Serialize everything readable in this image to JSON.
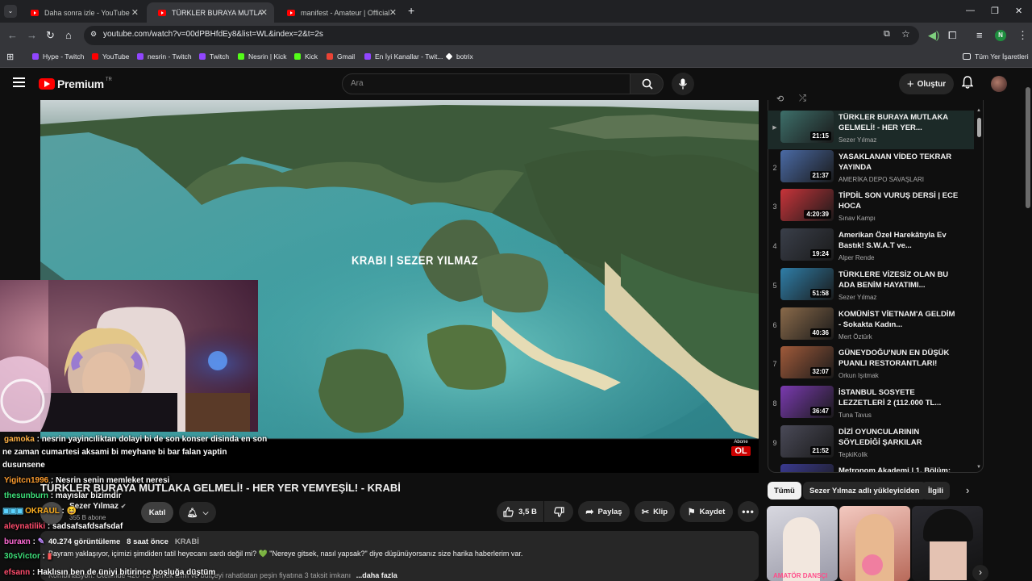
{
  "browser": {
    "tabs": [
      {
        "title": "Daha sonra izle - YouTube"
      },
      {
        "title": "TÜRKLER BURAYA MUTLAKA G"
      },
      {
        "title": "manifest - Amateur | Official M"
      }
    ],
    "url": "youtube.com/watch?v=00dPBHfdEy8&list=WL&index=2&t=2s",
    "profile_initial": "N",
    "bookmarks": [
      {
        "label": "Hype - Twitch",
        "color": "#9146ff"
      },
      {
        "label": "YouTube",
        "color": "#ff0000"
      },
      {
        "label": "nesrin - Twitch",
        "color": "#9146ff"
      },
      {
        "label": "Twitch",
        "color": "#9146ff"
      },
      {
        "label": "Nesrin | Kick",
        "color": "#53fc18"
      },
      {
        "label": "Kick",
        "color": "#53fc18"
      },
      {
        "label": "Gmail",
        "color": "#ea4335"
      },
      {
        "label": "En İyi Kanallar - Twit...",
        "color": "#9146ff"
      },
      {
        "label": "botrix",
        "color": "#ffffff"
      }
    ],
    "all_bookmarks": "Tüm Yer İşaretleri"
  },
  "youtube": {
    "logo_text": "Premium",
    "country": "TR",
    "search_placeholder": "Ara",
    "create_label": "Oluştur"
  },
  "video": {
    "overlay_text": "KRABI | SEZER YILMAZ",
    "subscribe_badge_line1": "Abone",
    "subscribe_badge_line2": "OL",
    "title": "TÜRKLER BURAYA MUTLAKA GELMELİ! - HER YER YEMYEŞİL! - KRABİ",
    "channel": "Sezer Yılmaz",
    "subscribers": "355 B abone",
    "join_label": "Katıl",
    "likes": "3,5 B",
    "share_label": "Paylaş",
    "clip_label": "Klip",
    "save_label": "Kaydet",
    "views": "40.274 görüntüleme",
    "age": "8 saat önce",
    "tag": "KRABİ",
    "desc_line1": "Bayram yaklaşıyor, içimizi şimdiden tatil heyecanı sardı değil mi? 💚 \"Nereye gitsek, nasıl yapsak?\" diye düşünüyorsanız size harika haberlerim var.",
    "desc_line2": "Kombinasyon: Otelimde 420 TL yemek alım ve bütçeyi rahatlatan peşin fiyatına 3 taksit imkanı",
    "more_label": "...daha fazla"
  },
  "chat": [
    {
      "user": "gamoka",
      "color": "#ffb347",
      "text": "nesrin yayincıliktan dolayi bi de son konser disinda en son"
    },
    {
      "user": "",
      "color": "#ffffff",
      "text": "ne zaman cumartesi aksami bi meyhane bi bar falan yaptin"
    },
    {
      "user": "",
      "color": "#ffffff",
      "text": "dusunsene"
    },
    {
      "user": "Yigitcn1996",
      "color": "#ff9d2e",
      "text": "Nesrin senin memleket neresi"
    },
    {
      "user": "thesunburn",
      "color": "#3ee07a",
      "text": "mayıslar bizimdir"
    },
    {
      "user": "OKRAUL",
      "color": "#ffb020",
      "text": "😆"
    },
    {
      "user": "aleynatiliki",
      "color": "#ff4d6d",
      "text": "sadsafsafdsafsdaf"
    },
    {
      "user": "buraкn",
      "color": "#ff6ad5",
      "text": ""
    },
    {
      "user": "30sVictor",
      "color": "#3ee07a",
      "text": ""
    },
    {
      "user": "efsann",
      "color": "#ff4d6d",
      "text": "Haklısın ben de üniyi bitirince boşluğa düştüm"
    }
  ],
  "playlist": [
    {
      "num": "▶",
      "title": "TÜRKLER BURAYA MUTLAKA GELMELİ! - HER YER...",
      "channel": "Sezer Yılmaz",
      "duration": "21:15",
      "thumb": "#3d6f6a",
      "active": true
    },
    {
      "num": "2",
      "title": "YASAKLANAN VİDEO TEKRAR YAYINDA",
      "channel": "AMERİKA DEPO SAVAŞLARI",
      "duration": "21:37",
      "thumb": "#4a6aa5"
    },
    {
      "num": "3",
      "title": "TİPDİL SON VURUŞ DERSİ | ECE HOCA",
      "channel": "Sınav Kampı",
      "duration": "4:20:39",
      "thumb": "#c8343a"
    },
    {
      "num": "4",
      "title": "Amerikan Özel Harekâtıyla Ev Bastık! S.W.A.T ve...",
      "channel": "Alper Rende",
      "duration": "19:24",
      "thumb": "#3a3f4a"
    },
    {
      "num": "5",
      "title": "TÜRKLERE VİZESİZ OLAN BU ADA BENİM HAYATIMI...",
      "channel": "Sezer Yılmaz",
      "duration": "51:58",
      "thumb": "#2f7ea8"
    },
    {
      "num": "6",
      "title": "KOMÜNİST VİETNAM'A GELDİM - Sokakta Kadın...",
      "channel": "Mert Öztürk",
      "duration": "40:36",
      "thumb": "#8a6a4a"
    },
    {
      "num": "7",
      "title": "GÜNEYDOĞU'NUN EN DÜŞÜK PUANLI RESTORANTLARI!",
      "channel": "Orkun Işıtmak",
      "duration": "32:07",
      "thumb": "#a05a3a"
    },
    {
      "num": "8",
      "title": "İSTANBUL SOSYETE LEZZETLERİ 2 (112.000 TL...",
      "channel": "Tuna Tavus",
      "duration": "36:47",
      "thumb": "#7a3ab0"
    },
    {
      "num": "9",
      "title": "DİZİ OYUNCULARININ SÖYLEDİĞİ ŞARKILAR",
      "channel": "TepkiKolik",
      "duration": "21:52",
      "thumb": "#4a4a58"
    },
    {
      "num": "",
      "title": "Metronom Akademi | 1. Bölüm:",
      "channel": "",
      "duration": "",
      "thumb": "#3a3a90"
    }
  ],
  "chips": [
    "Tümü",
    "Sezer Yılmaz adlı yükleyiciden",
    "İlgili"
  ],
  "reco_thumb_label": "AMATÖR DANSÇI"
}
